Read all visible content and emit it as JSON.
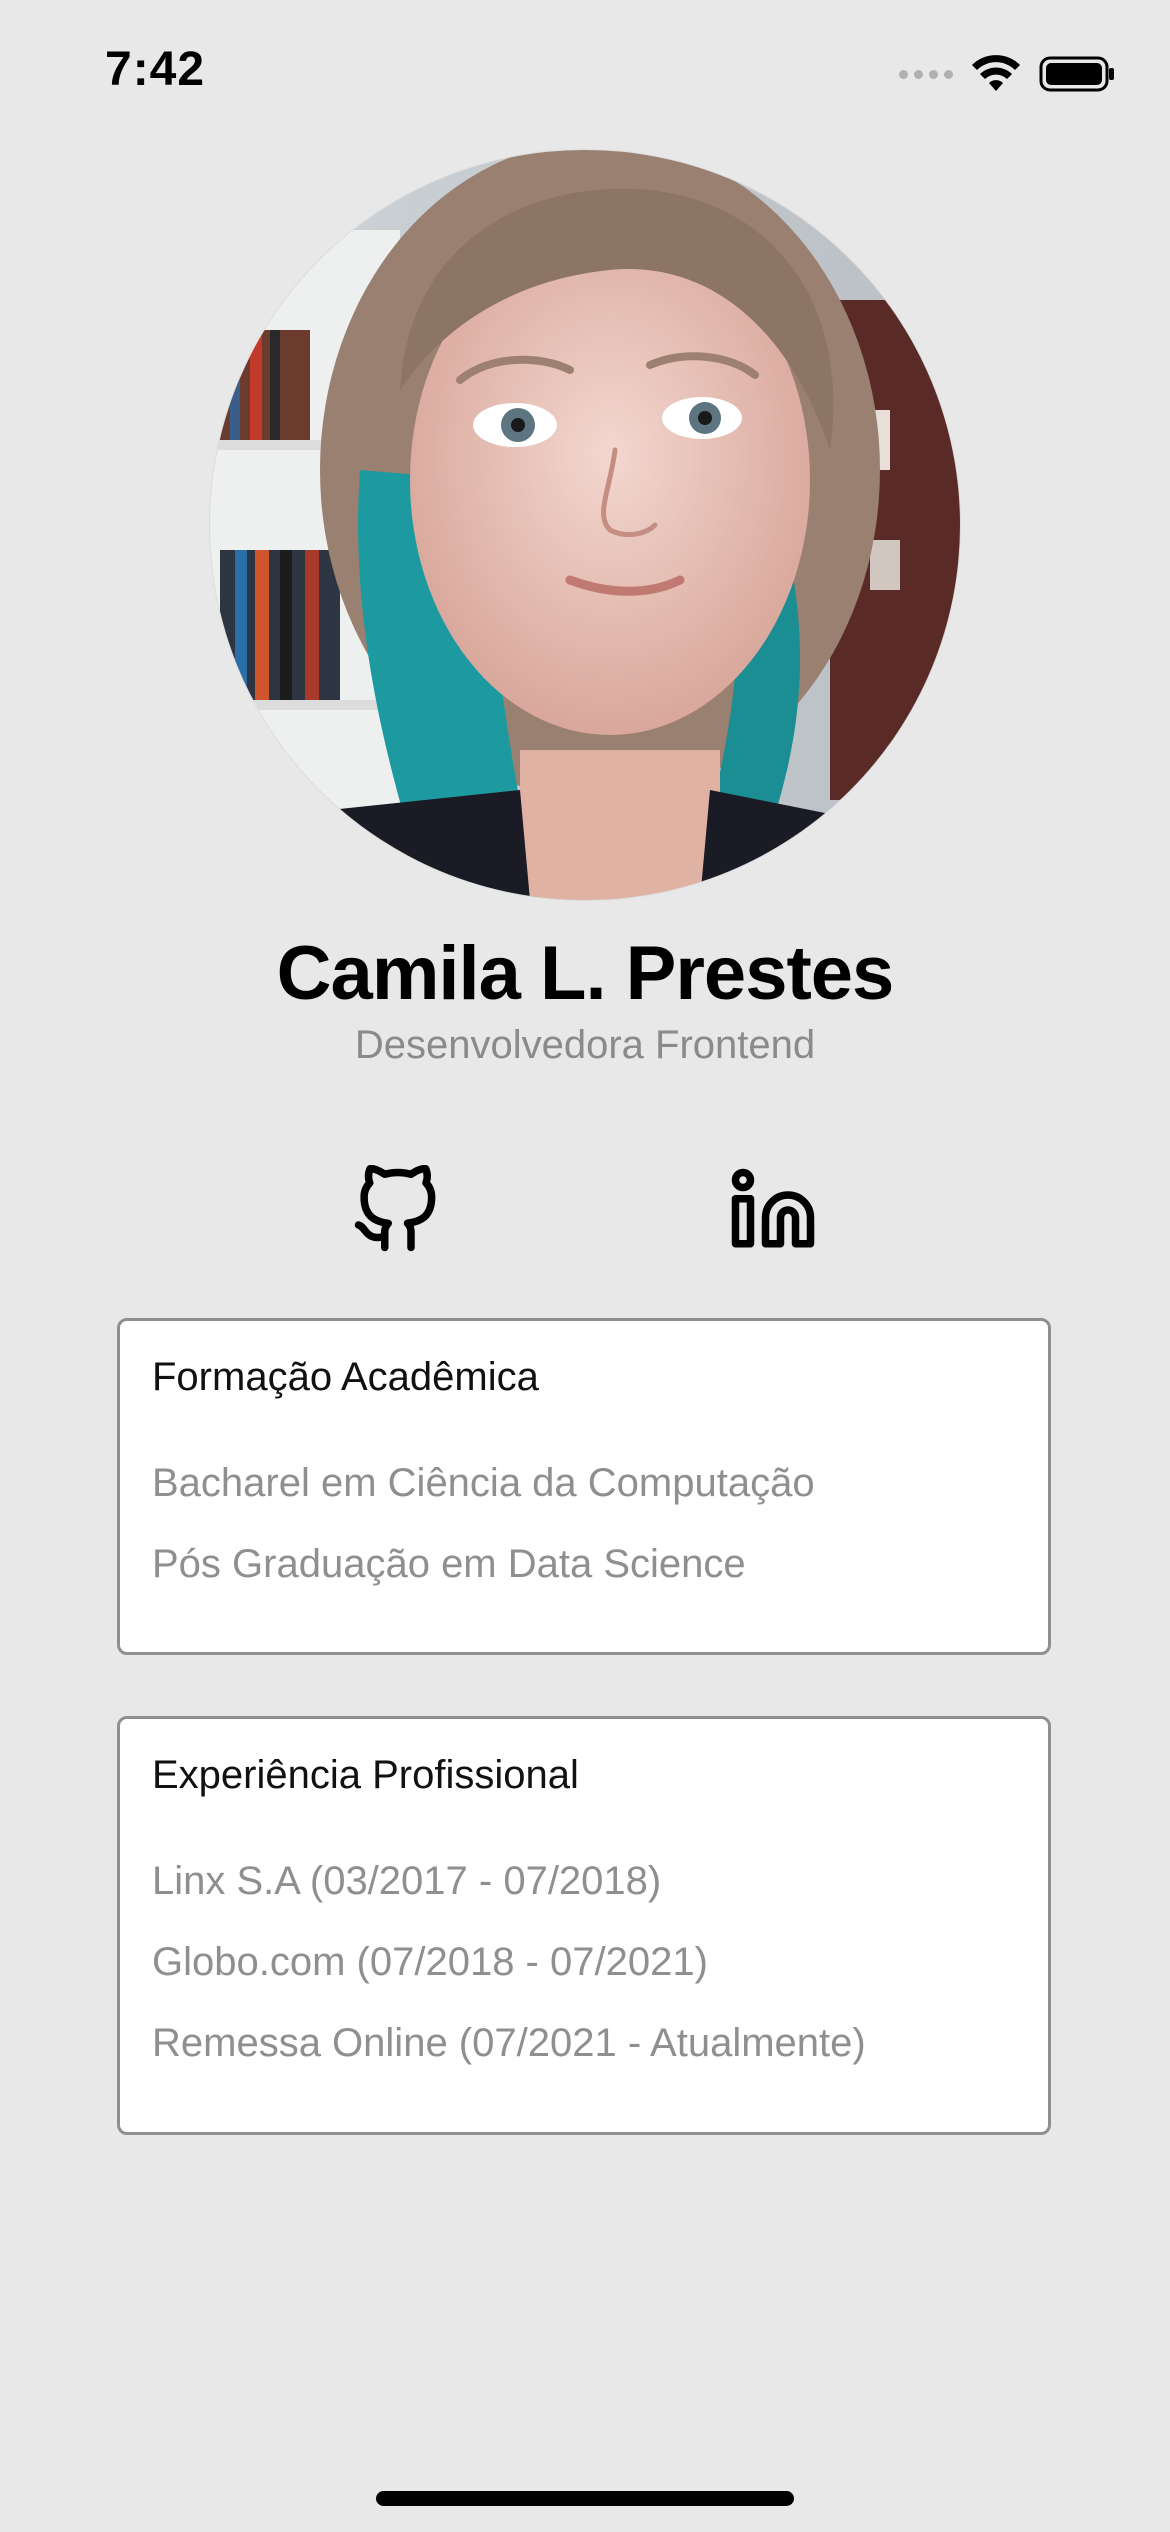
{
  "status_bar": {
    "time": "7:42",
    "signal_icon": "cellular-signal-icon",
    "wifi_icon": "wifi-icon",
    "battery_icon": "battery-icon"
  },
  "profile": {
    "name": "Camila L. Prestes",
    "role": "Desenvolvedora Frontend",
    "avatar_icon": "profile-photo"
  },
  "social": {
    "github_icon": "github-icon",
    "linkedin_icon": "linkedin-icon"
  },
  "education": {
    "title": "Formação Acadêmica",
    "items": [
      "Bacharel em Ciência da Computação",
      "Pós Graduação em Data Science"
    ]
  },
  "experience": {
    "title": "Experiência Profissional",
    "items": [
      "Linx S.A (03/2017 - 07/2018)",
      "Globo.com (07/2018 - 07/2021)",
      "Remessa Online (07/2021 - Atualmente)"
    ]
  },
  "colors": {
    "background": "#e8e8e8",
    "card_border": "#8f8f8f",
    "muted_text": "#8a8a8a",
    "hair_teal": "#1d9aa0"
  }
}
